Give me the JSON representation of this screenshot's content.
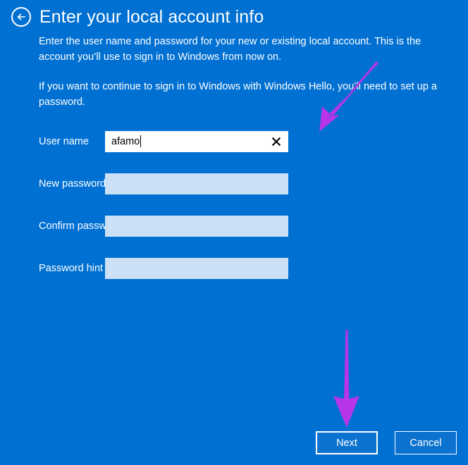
{
  "header": {
    "back_label": "Back",
    "back_icon": "arrow-left-circle-icon",
    "title": "Enter your local account info"
  },
  "description": {
    "paragraph1": "Enter the user name and password for your new or existing local account. This is the account you’ll use to sign in to Windows from now on.",
    "paragraph2": "If you want to continue to sign in to Windows with Windows Hello, you’ll need to set up a password."
  },
  "form": {
    "fields": [
      {
        "label": "User name",
        "value": "afamo",
        "placeholder": "",
        "type": "text",
        "active": true,
        "clear_icon": "close-icon"
      },
      {
        "label": "New password",
        "value": "",
        "placeholder": "",
        "type": "password",
        "active": false,
        "clear_icon": ""
      },
      {
        "label": "Confirm password",
        "value": "",
        "placeholder": "",
        "type": "password",
        "active": false,
        "clear_icon": ""
      },
      {
        "label": "Password hint",
        "value": "",
        "placeholder": "",
        "type": "text",
        "active": false,
        "clear_icon": ""
      }
    ]
  },
  "footer": {
    "next_label": "Next",
    "cancel_label": "Cancel"
  },
  "annotations": [
    {
      "name": "arrow-pointing-to-username-field",
      "direction": "down-left"
    },
    {
      "name": "arrow-pointing-to-next-button",
      "direction": "down"
    }
  ],
  "colors": {
    "background": "#0070d2",
    "field_empty": "#cbe0f4",
    "field_active": "#ffffff",
    "text": "#ffffff",
    "annotation": "#b635e8",
    "button_face": "#0b72cf"
  }
}
